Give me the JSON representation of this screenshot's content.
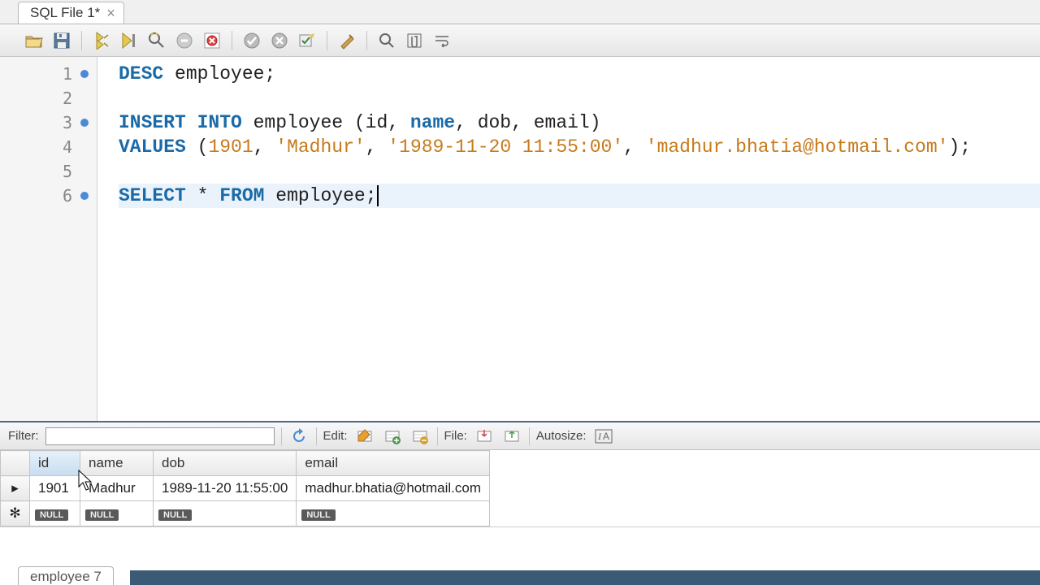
{
  "tab": {
    "title": "SQL File 1*"
  },
  "toolbar_icons": [
    "open",
    "save",
    "execute",
    "execute-current",
    "explain",
    "stop",
    "reconnect",
    "commit",
    "rollback",
    "autocommit",
    "beautify",
    "search",
    "show-invisible",
    "wrap"
  ],
  "code": {
    "lines": [
      {
        "num": 1,
        "marked": true,
        "tokens": [
          [
            "kw",
            "DESC"
          ],
          [
            "txt",
            " employee;"
          ]
        ]
      },
      {
        "num": 2,
        "marked": false,
        "tokens": []
      },
      {
        "num": 3,
        "marked": true,
        "tokens": [
          [
            "kw",
            "INSERT INTO"
          ],
          [
            "txt",
            " employee (id, "
          ],
          [
            "kw",
            "name"
          ],
          [
            "txt",
            ", dob, email)"
          ]
        ]
      },
      {
        "num": 4,
        "marked": false,
        "tokens": [
          [
            "kw",
            "VALUES"
          ],
          [
            "txt",
            " ("
          ],
          [
            "num",
            "1901"
          ],
          [
            "txt",
            ", "
          ],
          [
            "str",
            "'Madhur'"
          ],
          [
            "txt",
            ", "
          ],
          [
            "str",
            "'1989-11-20 11:55:00'"
          ],
          [
            "txt",
            ", "
          ],
          [
            "str",
            "'madhur.bhatia@hotmail.com'"
          ],
          [
            "txt",
            ");"
          ]
        ]
      },
      {
        "num": 5,
        "marked": false,
        "tokens": []
      },
      {
        "num": 6,
        "marked": true,
        "hl": true,
        "cursor": true,
        "tokens": [
          [
            "kw",
            "SELECT"
          ],
          [
            "txt",
            " * "
          ],
          [
            "kw",
            "FROM"
          ],
          [
            "txt",
            " employee;"
          ]
        ]
      }
    ]
  },
  "results_bar": {
    "filter_label": "Filter:",
    "filter_value": "",
    "edit_label": "Edit:",
    "file_label": "File:",
    "autosize_label": "Autosize:"
  },
  "grid": {
    "columns": [
      "id",
      "name",
      "dob",
      "email"
    ],
    "selected_column": 0,
    "rows": [
      {
        "marker": "current",
        "cells": [
          "1901",
          "Madhur",
          "1989-11-20 11:55:00",
          "madhur.bhatia@hotmail.com"
        ]
      },
      {
        "marker": "new",
        "cells": [
          "NULL",
          "NULL",
          "NULL",
          "NULL"
        ],
        "null_row": true
      }
    ]
  },
  "footer_tab": "employee 7"
}
